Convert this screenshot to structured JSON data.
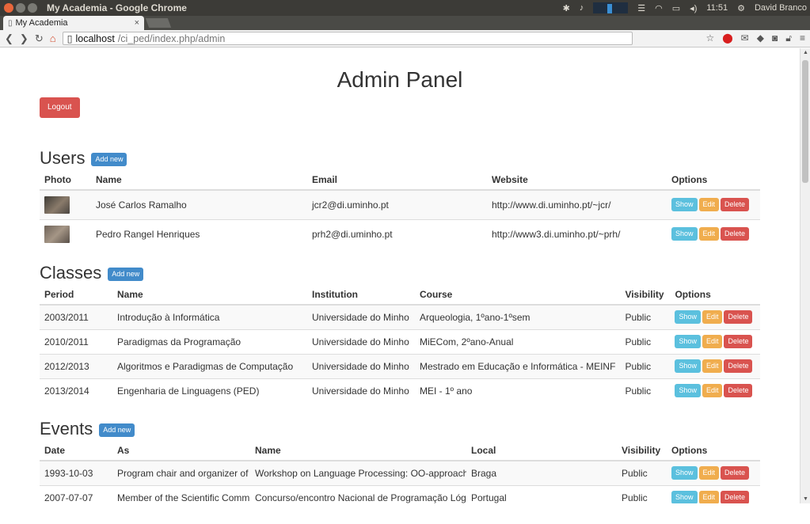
{
  "window": {
    "title": "My Academia - Google Chrome"
  },
  "tray": {
    "time": "11:51",
    "user": "David Branco"
  },
  "tab": {
    "title": "My Academia"
  },
  "address": {
    "host": "localhost",
    "path": "/ci_ped/index.php/admin"
  },
  "page": {
    "title": "Admin Panel",
    "logout_label": "Logout",
    "add_new_label": "Add new"
  },
  "row_actions": {
    "show": "Show",
    "edit": "Edit",
    "delete": "Delete"
  },
  "users": {
    "heading": "Users",
    "columns": [
      "Photo",
      "Name",
      "Email",
      "Website",
      "Options"
    ],
    "rows": [
      {
        "name": "José Carlos Ramalho",
        "email": "jcr2@di.uminho.pt",
        "website": "http://www.di.uminho.pt/~jcr/"
      },
      {
        "name": "Pedro Rangel Henriques",
        "email": "prh2@di.uminho.pt",
        "website": "http://www3.di.uminho.pt/~prh/"
      }
    ]
  },
  "classes": {
    "heading": "Classes",
    "columns": [
      "Period",
      "Name",
      "Institution",
      "Course",
      "Visibility",
      "Options"
    ],
    "rows": [
      {
        "period": "2003/2011",
        "name": "Introdução à Informática",
        "institution": "Universidade do Minho",
        "course": "Arqueologia, 1ºano-1ºsem",
        "visibility": "Public"
      },
      {
        "period": "2010/2011",
        "name": "Paradigmas da Programação",
        "institution": "Universidade do Minho",
        "course": "MiECom, 2ºano-Anual",
        "visibility": "Public"
      },
      {
        "period": "2012/2013",
        "name": "Algoritmos e Paradigmas de Computação",
        "institution": "Universidade do Minho",
        "course": "Mestrado em Educação e Informática - MEINF",
        "visibility": "Public"
      },
      {
        "period": "2013/2014",
        "name": "Engenharia de Linguagens (PED)",
        "institution": "Universidade do Minho",
        "course": "MEI - 1º ano",
        "visibility": "Public"
      }
    ]
  },
  "events": {
    "heading": "Events",
    "columns": [
      "Date",
      "As",
      "Name",
      "Local",
      "Visibility",
      "Options"
    ],
    "rows": [
      {
        "date": "1993-10-03",
        "as": "Program chair and organizer of",
        "name": "Workshop on Language Processing: OO-approache",
        "local": "Braga",
        "visibility": "Public"
      },
      {
        "date": "2007-07-07",
        "as": "Member of the Scientific Commi",
        "name": "Concurso/encontro Nacional de Programação Lógic",
        "local": "Portugal",
        "visibility": "Public"
      }
    ]
  }
}
